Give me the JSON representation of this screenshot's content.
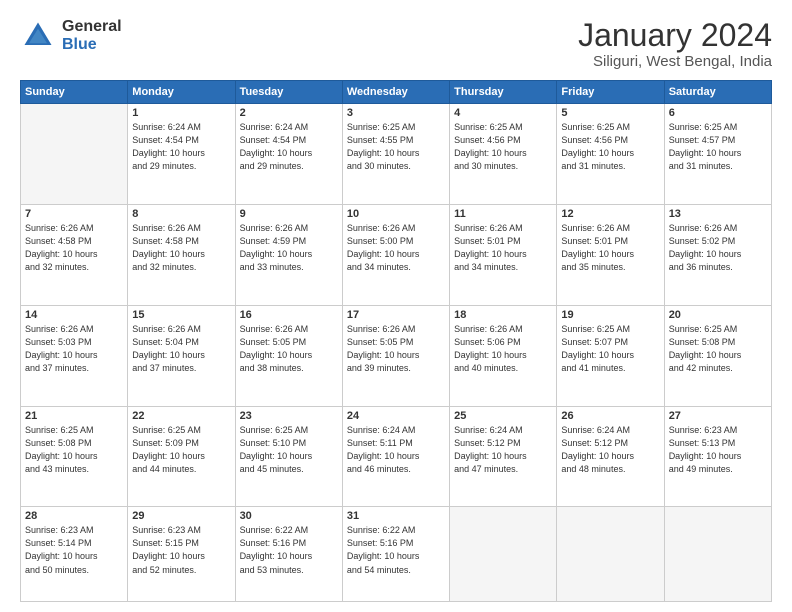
{
  "header": {
    "logo_general": "General",
    "logo_blue": "Blue",
    "title": "January 2024",
    "subtitle": "Siliguri, West Bengal, India"
  },
  "days_of_week": [
    "Sunday",
    "Monday",
    "Tuesday",
    "Wednesday",
    "Thursday",
    "Friday",
    "Saturday"
  ],
  "weeks": [
    [
      {
        "day": "",
        "info": ""
      },
      {
        "day": "1",
        "info": "Sunrise: 6:24 AM\nSunset: 4:54 PM\nDaylight: 10 hours\nand 29 minutes."
      },
      {
        "day": "2",
        "info": "Sunrise: 6:24 AM\nSunset: 4:54 PM\nDaylight: 10 hours\nand 29 minutes."
      },
      {
        "day": "3",
        "info": "Sunrise: 6:25 AM\nSunset: 4:55 PM\nDaylight: 10 hours\nand 30 minutes."
      },
      {
        "day": "4",
        "info": "Sunrise: 6:25 AM\nSunset: 4:56 PM\nDaylight: 10 hours\nand 30 minutes."
      },
      {
        "day": "5",
        "info": "Sunrise: 6:25 AM\nSunset: 4:56 PM\nDaylight: 10 hours\nand 31 minutes."
      },
      {
        "day": "6",
        "info": "Sunrise: 6:25 AM\nSunset: 4:57 PM\nDaylight: 10 hours\nand 31 minutes."
      }
    ],
    [
      {
        "day": "7",
        "info": "Sunrise: 6:26 AM\nSunset: 4:58 PM\nDaylight: 10 hours\nand 32 minutes."
      },
      {
        "day": "8",
        "info": "Sunrise: 6:26 AM\nSunset: 4:58 PM\nDaylight: 10 hours\nand 32 minutes."
      },
      {
        "day": "9",
        "info": "Sunrise: 6:26 AM\nSunset: 4:59 PM\nDaylight: 10 hours\nand 33 minutes."
      },
      {
        "day": "10",
        "info": "Sunrise: 6:26 AM\nSunset: 5:00 PM\nDaylight: 10 hours\nand 34 minutes."
      },
      {
        "day": "11",
        "info": "Sunrise: 6:26 AM\nSunset: 5:01 PM\nDaylight: 10 hours\nand 34 minutes."
      },
      {
        "day": "12",
        "info": "Sunrise: 6:26 AM\nSunset: 5:01 PM\nDaylight: 10 hours\nand 35 minutes."
      },
      {
        "day": "13",
        "info": "Sunrise: 6:26 AM\nSunset: 5:02 PM\nDaylight: 10 hours\nand 36 minutes."
      }
    ],
    [
      {
        "day": "14",
        "info": "Sunrise: 6:26 AM\nSunset: 5:03 PM\nDaylight: 10 hours\nand 37 minutes."
      },
      {
        "day": "15",
        "info": "Sunrise: 6:26 AM\nSunset: 5:04 PM\nDaylight: 10 hours\nand 37 minutes."
      },
      {
        "day": "16",
        "info": "Sunrise: 6:26 AM\nSunset: 5:05 PM\nDaylight: 10 hours\nand 38 minutes."
      },
      {
        "day": "17",
        "info": "Sunrise: 6:26 AM\nSunset: 5:05 PM\nDaylight: 10 hours\nand 39 minutes."
      },
      {
        "day": "18",
        "info": "Sunrise: 6:26 AM\nSunset: 5:06 PM\nDaylight: 10 hours\nand 40 minutes."
      },
      {
        "day": "19",
        "info": "Sunrise: 6:25 AM\nSunset: 5:07 PM\nDaylight: 10 hours\nand 41 minutes."
      },
      {
        "day": "20",
        "info": "Sunrise: 6:25 AM\nSunset: 5:08 PM\nDaylight: 10 hours\nand 42 minutes."
      }
    ],
    [
      {
        "day": "21",
        "info": "Sunrise: 6:25 AM\nSunset: 5:08 PM\nDaylight: 10 hours\nand 43 minutes."
      },
      {
        "day": "22",
        "info": "Sunrise: 6:25 AM\nSunset: 5:09 PM\nDaylight: 10 hours\nand 44 minutes."
      },
      {
        "day": "23",
        "info": "Sunrise: 6:25 AM\nSunset: 5:10 PM\nDaylight: 10 hours\nand 45 minutes."
      },
      {
        "day": "24",
        "info": "Sunrise: 6:24 AM\nSunset: 5:11 PM\nDaylight: 10 hours\nand 46 minutes."
      },
      {
        "day": "25",
        "info": "Sunrise: 6:24 AM\nSunset: 5:12 PM\nDaylight: 10 hours\nand 47 minutes."
      },
      {
        "day": "26",
        "info": "Sunrise: 6:24 AM\nSunset: 5:12 PM\nDaylight: 10 hours\nand 48 minutes."
      },
      {
        "day": "27",
        "info": "Sunrise: 6:23 AM\nSunset: 5:13 PM\nDaylight: 10 hours\nand 49 minutes."
      }
    ],
    [
      {
        "day": "28",
        "info": "Sunrise: 6:23 AM\nSunset: 5:14 PM\nDaylight: 10 hours\nand 50 minutes."
      },
      {
        "day": "29",
        "info": "Sunrise: 6:23 AM\nSunset: 5:15 PM\nDaylight: 10 hours\nand 52 minutes."
      },
      {
        "day": "30",
        "info": "Sunrise: 6:22 AM\nSunset: 5:16 PM\nDaylight: 10 hours\nand 53 minutes."
      },
      {
        "day": "31",
        "info": "Sunrise: 6:22 AM\nSunset: 5:16 PM\nDaylight: 10 hours\nand 54 minutes."
      },
      {
        "day": "",
        "info": ""
      },
      {
        "day": "",
        "info": ""
      },
      {
        "day": "",
        "info": ""
      }
    ]
  ]
}
